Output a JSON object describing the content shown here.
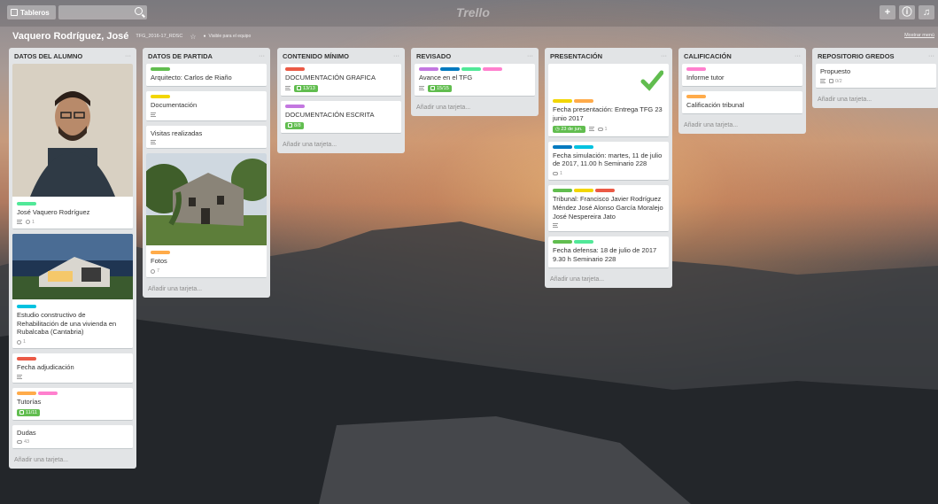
{
  "topbar": {
    "boards_label": "Tableros",
    "logo_text": "Trello"
  },
  "board": {
    "title": "Vaquero Rodríguez, José",
    "subtitle": "TFG_2016-17_RDSC",
    "visibility": "Visible para el equipo",
    "show_menu": "Mostrar menú"
  },
  "add_card_label": "Añadir una tarjeta...",
  "lists": [
    {
      "title": "DATOS DEL ALUMNO",
      "cards": [
        {
          "text": "José Vaquero Rodríguez",
          "labels": [
            "lime"
          ],
          "cover": "portrait",
          "desc": true,
          "attachments": "1"
        },
        {
          "text": "Estudio constructivo de Rehabilitación de una vivienda en Rubalcaba (Cantabria)",
          "labels": [
            "sky"
          ],
          "cover": "house",
          "attachments": "1"
        },
        {
          "text": "Fecha adjudicación",
          "labels": [
            "red"
          ],
          "desc": true
        },
        {
          "text": "Tutorías",
          "labels": [
            "orange",
            "pink"
          ],
          "checklist": "11/11",
          "checklist_done": true
        },
        {
          "text": "Dudas",
          "comments": "43"
        }
      ]
    },
    {
      "title": "DATOS DE PARTIDA",
      "cards": [
        {
          "text": "Arquitecto: Carlos de Riaño",
          "labels": [
            "green"
          ]
        },
        {
          "text": "Documentación",
          "labels": [
            "yellow"
          ],
          "desc": true
        },
        {
          "text": "Visitas realizadas",
          "desc": true
        },
        {
          "text": "Fotos",
          "labels": [
            "orange"
          ],
          "cover": "ruin",
          "attachments": "7"
        }
      ]
    },
    {
      "title": "CONTENIDO MÍNIMO",
      "cards": [
        {
          "text": "DOCUMENTACIÓN GRAFICA",
          "labels": [
            "red"
          ],
          "desc": true,
          "checklist": "13/13",
          "checklist_done": true
        },
        {
          "text": "DOCUMENTACIÓN ESCRITA",
          "labels": [
            "purple"
          ],
          "checklist": "8/8",
          "checklist_done": true
        }
      ]
    },
    {
      "title": "REVISADO",
      "cards": [
        {
          "text": "Avance en el TFG",
          "labels": [
            "purple",
            "blue",
            "lime",
            "pink"
          ],
          "desc": true,
          "checklist": "15/15",
          "checklist_done": true
        }
      ]
    },
    {
      "title": "PRESENTACIÓN",
      "cards": [
        {
          "text": "Fecha presentación: Entrega TFG 23 junio 2017",
          "labels": [
            "yellow",
            "orange"
          ],
          "cover": "check",
          "due": "23 de jun.",
          "desc": true,
          "comments": "1"
        },
        {
          "text": "Fecha simulación: martes, 11 de julio de 2017, 11.00 h Seminario 228",
          "labels": [
            "blue",
            "sky"
          ],
          "comments": "1"
        },
        {
          "text": "Tribunal: Francisco Javier Rodríguez Méndez José Alonso García Moralejo José Nespereira Jato",
          "labels": [
            "green",
            "yellow",
            "red"
          ],
          "desc": true
        },
        {
          "text": "Fecha defensa: 18 de julio de 2017 9.30 h Seminario 228",
          "labels": [
            "green",
            "lime"
          ]
        }
      ]
    },
    {
      "title": "CALIFICACIÓN",
      "cards": [
        {
          "text": "Informe tutor",
          "labels": [
            "pink"
          ]
        },
        {
          "text": "Calificación tribunal",
          "labels": [
            "orange"
          ]
        }
      ]
    },
    {
      "title": "REPOSITORIO GREDOS",
      "cards": [
        {
          "text": "Propuesto",
          "desc": true,
          "checklist": "0/2",
          "checklist_done": false
        }
      ]
    }
  ],
  "colors": {
    "green": "#61bd4f",
    "yellow": "#f2d600",
    "orange": "#ffab4a",
    "red": "#eb5a46",
    "purple": "#c377e0",
    "blue": "#0079bf",
    "sky": "#00c2e0",
    "lime": "#51e898",
    "pink": "#ff80ce"
  }
}
